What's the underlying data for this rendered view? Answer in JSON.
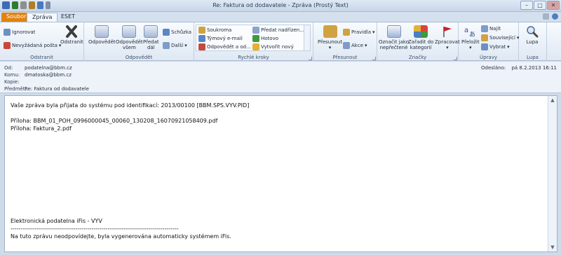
{
  "window": {
    "title": "Re: Faktura od dodavatele - Zpráva (Prostý Text)",
    "min_glyph": "–",
    "max_glyph": "□",
    "close_glyph": "✕"
  },
  "tabs": [
    {
      "label": "Soubor"
    },
    {
      "label": "Zpráva"
    },
    {
      "label": "ESET"
    }
  ],
  "ribbon": {
    "groups": {
      "delete": "Odstranit",
      "respond": "Odpovědět",
      "quick_steps": "Rychlé kroky",
      "move": "Přesunout",
      "tags": "Značky",
      "editing": "Úpravy",
      "zoom": "Lupa"
    },
    "ignore": "Ignorovat",
    "junk": "Nevyžádaná pošta",
    "delete_btn": "Odstranit",
    "reply": "Odpovědět",
    "reply_all_1": "Odpovědět",
    "reply_all_2": "všem",
    "forward_1": "Předat",
    "forward_2": "dál",
    "meeting": "Schůzka",
    "more": "Další",
    "qs_private": "Soukroma",
    "qs_team": "Týmový e-mail",
    "qs_reply_del": "Odpovědět a od...",
    "qs_manager": "Předat nadřízen...",
    "qs_done": "Hotovo",
    "qs_new": "Vytvořit nový",
    "move_btn": "Přesunout",
    "rules": "Pravidla",
    "actions": "Akce",
    "mark_unread_1": "Označit jako",
    "mark_unread_2": "nepřečtené",
    "categorize_1": "Zařadit do",
    "categorize_2": "kategorií",
    "follow_up": "Zpracovat",
    "translate": "Přeložit",
    "find": "Najít",
    "related": "Související",
    "select": "Vybrat",
    "zoom_btn": "Lupa"
  },
  "header": {
    "from_label": "Od:",
    "from_value": "podatelna@bbm.cz",
    "to_label": "Komu:",
    "to_value": "dmatoska@bbm.cz",
    "cc_label": "Kopie:",
    "cc_value": "",
    "subject_label": "Předmět:",
    "subject_value": "Re: Faktura od dodavatele",
    "sent_label": "Odesláno:",
    "sent_value": "pá 8.2.2013 16:11"
  },
  "body": {
    "line1": "Vaše zpráva byla přijata do systému pod identifikací: 2013/00100 [BBM.SPS.VYV.PID]",
    "attach1": "Příloha: BBM_01_POH_0996000045_00060_130208_16070921058409.pdf",
    "attach2": "Příloha: Faktura_2.pdf",
    "signature": "Elektronická podatelna iFis - VYV",
    "separator": "------------------------------------------------------------------------------------",
    "notice": "Na tuto zprávu neodpovídejte, byla vygenerována automaticky systémem iFis."
  },
  "colors": {
    "file_tab": "#e2830e",
    "ribbon_bg": "#dfe8f3",
    "flag": "#c8202a"
  }
}
